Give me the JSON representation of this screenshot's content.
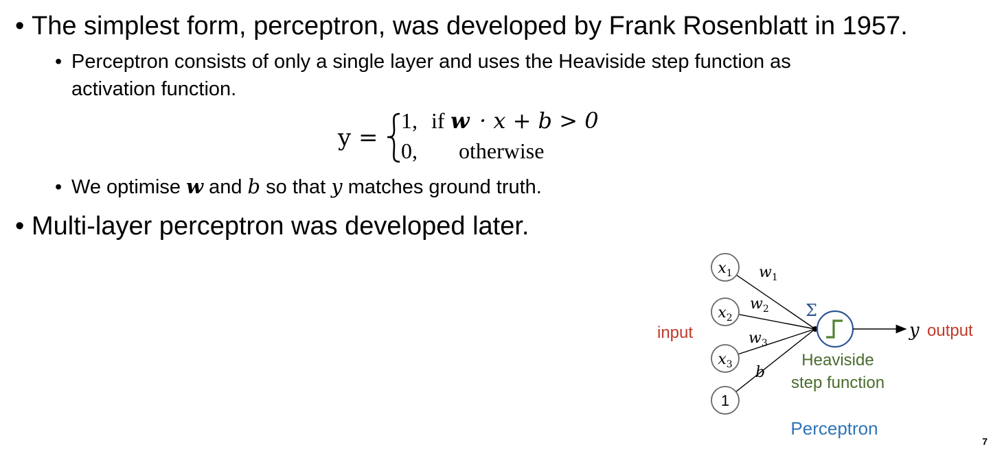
{
  "bullets": {
    "b1": "The simplest form, perceptron, was developed by Frank Rosenblatt in 1957.",
    "b1_sub1_line1": "Perceptron consists of only a single layer and uses the Heaviside step function as",
    "b1_sub1_line2": "activation function.",
    "b1_sub2_pre": "We optimise ",
    "b1_sub2_w": "w",
    "b1_sub2_and": " and ",
    "b1_sub2_b": "b",
    "b1_sub2_mid": " so that ",
    "b1_sub2_y": "y",
    "b1_sub2_post": " matches ground truth.",
    "b2": "Multi-layer perceptron was developed later."
  },
  "formula": {
    "lhs": "y =",
    "case1_value": "1,",
    "case1_if": "if",
    "case1_w": "w",
    "case1_rest": "· x + b > 0",
    "case2_value": "0,",
    "case2_text": "otherwise"
  },
  "diagram": {
    "inputs": [
      {
        "base": "x",
        "sub": "1"
      },
      {
        "base": "x",
        "sub": "2"
      },
      {
        "base": "x",
        "sub": "3"
      },
      {
        "base": "1",
        "sub": ""
      }
    ],
    "weights": [
      {
        "base": "w",
        "sub": "1"
      },
      {
        "base": "w",
        "sub": "2"
      },
      {
        "base": "w",
        "sub": "3"
      },
      {
        "base": "b",
        "sub": ""
      }
    ],
    "sigma": "Σ",
    "input_label": "input",
    "output_symbol": "y",
    "output_label": "output",
    "activation_label_line1": "Heaviside",
    "activation_label_line2": "step function",
    "caption": "Perceptron",
    "colors": {
      "red_label": "#c0392b",
      "green": "#548235",
      "green_text": "#4a6b2e",
      "blue": "#2e75b6",
      "neuron_stroke": "#2f5597",
      "node_stroke": "#666666"
    }
  },
  "page_number": "7"
}
